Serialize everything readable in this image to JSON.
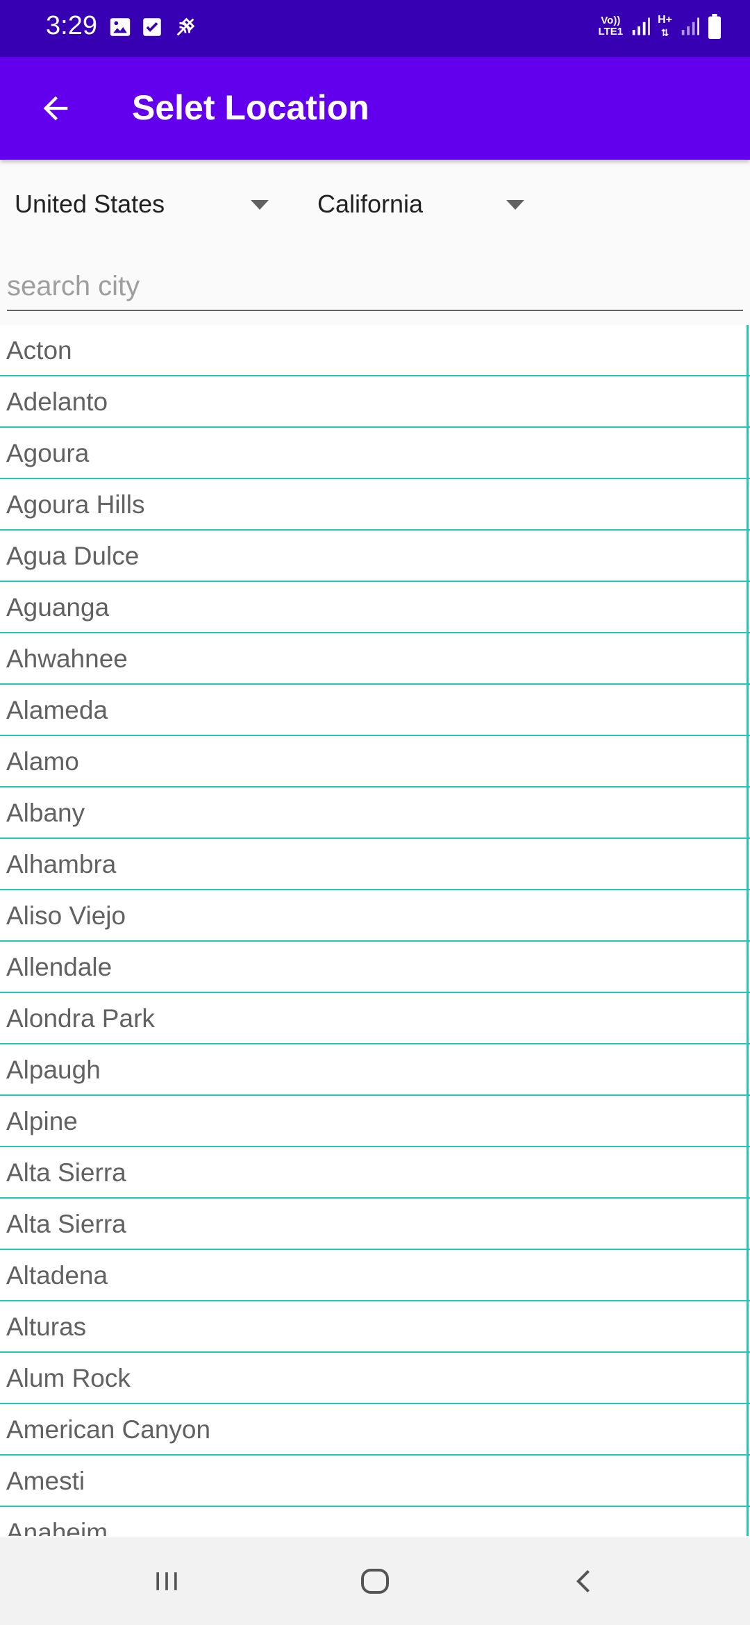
{
  "status_bar": {
    "time": "3:29",
    "left_icons": [
      "image-icon",
      "checkbox-icon",
      "satellite-off-icon"
    ],
    "right_icons": [
      "volte-lte-icon",
      "signal-icon",
      "h-plus-data-icon",
      "signal-icon",
      "battery-icon"
    ],
    "network_label_1": "Vo))",
    "network_label_2": "LTE1",
    "data_label": "H+",
    "bg_color": "#3700b3"
  },
  "app_bar": {
    "title": "Selet Location",
    "back_icon": "arrow-back-icon",
    "bg_color": "#6200ee"
  },
  "filters": {
    "country": "United States",
    "state": "California"
  },
  "search": {
    "value": "",
    "placeholder": "search city"
  },
  "cities": [
    "Acton",
    "Adelanto",
    "Agoura",
    "Agoura Hills",
    "Agua Dulce",
    "Aguanga",
    "Ahwahnee",
    "Alameda",
    "Alamo",
    "Albany",
    "Alhambra",
    "Aliso Viejo",
    "Allendale",
    "Alondra Park",
    "Alpaugh",
    "Alpine",
    "Alta Sierra",
    "Alta Sierra",
    "Altadena",
    "Alturas",
    "Alum Rock",
    "American Canyon",
    "Amesti",
    "Anaheim"
  ],
  "list_divider_color": "#1ec9b5",
  "nav_bar": {
    "buttons": [
      "recent-apps-icon",
      "home-icon",
      "back-icon"
    ]
  }
}
